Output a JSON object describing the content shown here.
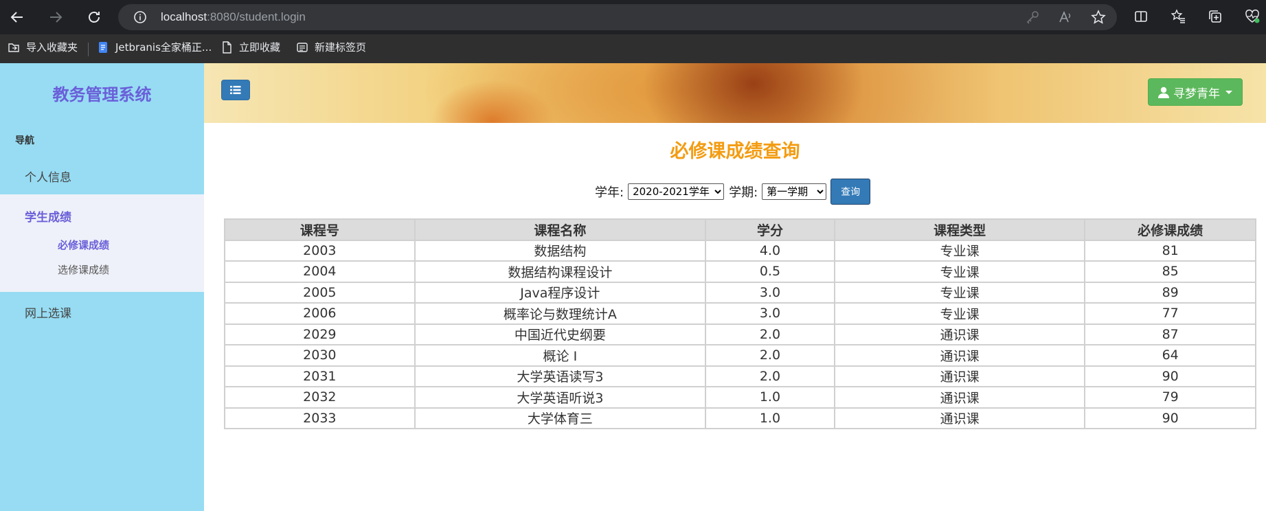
{
  "browser": {
    "url_host": "localhost",
    "url_rest": ":8080/student.login",
    "bookmarks": [
      "导入收藏夹",
      "Jetbranis全家桶正...",
      "立即收藏",
      "新建标签页"
    ]
  },
  "sidebar": {
    "brand": "教务管理系统",
    "nav_label": "导航",
    "items": [
      {
        "label": "个人信息"
      },
      {
        "label": "学生成绩",
        "children": [
          {
            "label": "必修课成绩",
            "active": true
          },
          {
            "label": "选修课成绩",
            "active": false
          }
        ]
      },
      {
        "label": "网上选课"
      }
    ]
  },
  "header": {
    "user_name": "寻梦青年"
  },
  "main": {
    "title": "必修课成绩查询",
    "year_label": "学年:",
    "year_selected": "2020-2021学年",
    "term_label": "学期:",
    "term_selected": "第一学期",
    "query_label": "查询",
    "table": {
      "columns": [
        "课程号",
        "课程名称",
        "学分",
        "课程类型",
        "必修课成绩"
      ],
      "rows": [
        [
          "2003",
          "数据结构",
          "4.0",
          "专业课",
          "81"
        ],
        [
          "2004",
          "数据结构课程设计",
          "0.5",
          "专业课",
          "85"
        ],
        [
          "2005",
          "Java程序设计",
          "3.0",
          "专业课",
          "89"
        ],
        [
          "2006",
          "概率论与数理统计A",
          "3.0",
          "专业课",
          "77"
        ],
        [
          "2029",
          "中国近代史纲要",
          "2.0",
          "通识课",
          "87"
        ],
        [
          "2030",
          "概论 I",
          "2.0",
          "通识课",
          "64"
        ],
        [
          "2031",
          "大学英语读写3",
          "2.0",
          "通识课",
          "90"
        ],
        [
          "2032",
          "大学英语听说3",
          "1.0",
          "通识课",
          "79"
        ],
        [
          "2033",
          "大学体育三",
          "1.0",
          "通识课",
          "90"
        ]
      ]
    }
  },
  "colors": {
    "sidebar_bg": "#97dcf3",
    "brand": "#6a5fd9",
    "title": "#f39c12",
    "primary": "#337ab7",
    "success": "#5cb85c"
  },
  "icons": {
    "back": "arrow-left-icon",
    "forward": "arrow-right-icon",
    "reload": "reload-icon",
    "info": "info-icon",
    "key": "key-icon",
    "read_aloud": "read-aloud-icon",
    "favorite": "star-icon",
    "split": "split-screen-icon",
    "favorites": "favorites-list-icon",
    "collections": "collections-icon",
    "performance": "heart-pulse-icon",
    "menu": "list-icon",
    "user": "user-icon"
  }
}
